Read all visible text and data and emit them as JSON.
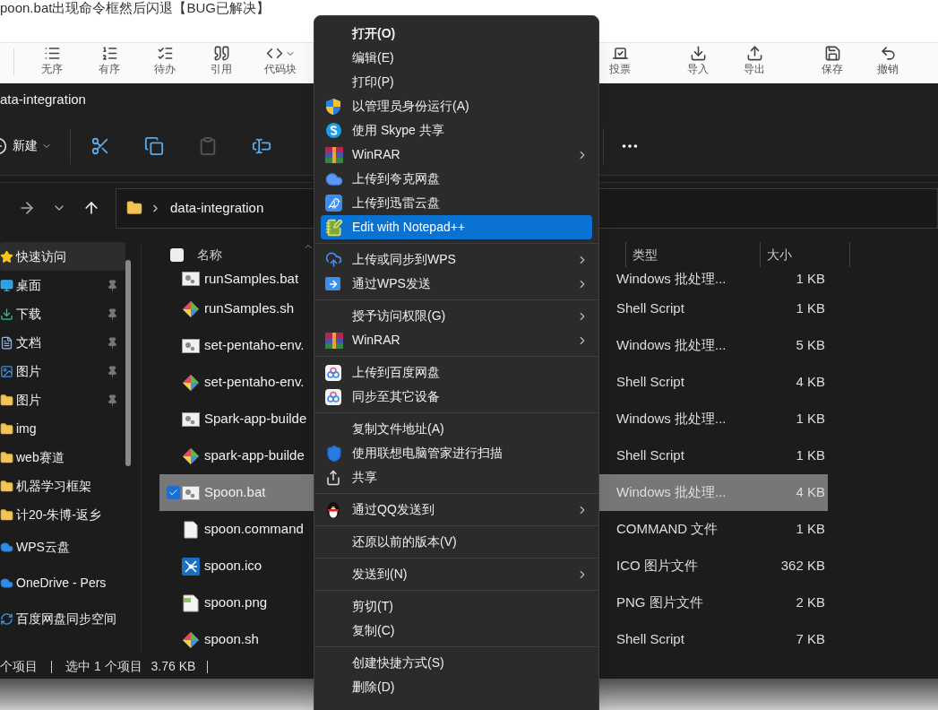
{
  "article": {
    "title": "poon.bat出现命令框然后闪退【BUG已解决】",
    "toolbar": [
      {
        "label": "无序"
      },
      {
        "label": "有序"
      },
      {
        "label": "待办"
      },
      {
        "label": "引用"
      },
      {
        "label": "代码块"
      },
      {
        "label": "投票"
      },
      {
        "label": "导入"
      },
      {
        "label": "导出"
      },
      {
        "label": "保存"
      },
      {
        "label": "撤销"
      }
    ]
  },
  "explorer": {
    "title": "ata-integration",
    "command_bar": {
      "new_label": "新建"
    },
    "address": {
      "path": "data-integration"
    },
    "sidebar": [
      {
        "label": "快速访问",
        "kind": "star",
        "pinned": false,
        "selected": true
      },
      {
        "label": "桌面",
        "kind": "desktop",
        "pinned": true,
        "selected": false
      },
      {
        "label": "下载",
        "kind": "download",
        "pinned": true,
        "selected": false
      },
      {
        "label": "文档",
        "kind": "document",
        "pinned": true,
        "selected": false
      },
      {
        "label": "图片",
        "kind": "picture",
        "pinned": true,
        "selected": false
      },
      {
        "label": "图片",
        "kind": "folder",
        "pinned": true,
        "selected": false
      },
      {
        "label": "img",
        "kind": "folder",
        "pinned": false,
        "selected": false
      },
      {
        "label": "web赛道",
        "kind": "folder",
        "pinned": false,
        "selected": false
      },
      {
        "label": "机器学习框架",
        "kind": "folder",
        "pinned": false,
        "selected": false
      },
      {
        "label": "计20-朱博-返乡",
        "kind": "folder",
        "pinned": false,
        "selected": false
      },
      {
        "label": "WPS云盘",
        "kind": "cloud",
        "pinned": false,
        "selected": false
      },
      {
        "label": "OneDrive - Pers",
        "kind": "cloud",
        "pinned": false,
        "selected": false
      },
      {
        "label": "百度网盘同步空间",
        "kind": "sync",
        "pinned": false,
        "selected": false
      }
    ],
    "columns": [
      "名称",
      "类型",
      "大小"
    ],
    "select_all": {
      "checked": false
    },
    "files": [
      {
        "name": "runSamples.bat",
        "type": "Windows 批处理...",
        "size": "1 KB",
        "kind": "bat",
        "selected": false
      },
      {
        "name": "runSamples.sh",
        "type": "Shell Script",
        "size": "1 KB",
        "kind": "sh",
        "selected": false
      },
      {
        "name": "set-pentaho-env.",
        "type": "Windows 批处理...",
        "size": "5 KB",
        "kind": "bat",
        "selected": false
      },
      {
        "name": "set-pentaho-env.",
        "type": "Shell Script",
        "size": "4 KB",
        "kind": "sh",
        "selected": false
      },
      {
        "name": "Spark-app-builde",
        "type": "Windows 批处理...",
        "size": "1 KB",
        "kind": "bat",
        "selected": false
      },
      {
        "name": "spark-app-builde",
        "type": "Shell Script",
        "size": "1 KB",
        "kind": "sh",
        "selected": false
      },
      {
        "name": "Spoon.bat",
        "type": "Windows 批处理...",
        "size": "4 KB",
        "kind": "bat",
        "selected": true
      },
      {
        "name": "spoon.command",
        "type": "COMMAND 文件",
        "size": "1 KB",
        "kind": "blank",
        "selected": false
      },
      {
        "name": "spoon.ico",
        "type": "ICO 图片文件",
        "size": "362 KB",
        "kind": "ico",
        "selected": false
      },
      {
        "name": "spoon.png",
        "type": "PNG 图片文件",
        "size": "2 KB",
        "kind": "png",
        "selected": false
      },
      {
        "name": "spoon.sh",
        "type": "Shell Script",
        "size": "7 KB",
        "kind": "sh",
        "selected": false
      }
    ],
    "status": [
      "个项目",
      "选中 1 个项目",
      "3.76 KB"
    ]
  },
  "context_menu": [
    [
      {
        "label": "打开(O)",
        "kind": "none",
        "default": true,
        "selected": false,
        "submenu": false
      },
      {
        "label": "编辑(E)",
        "kind": "none",
        "default": false,
        "selected": false,
        "submenu": false
      },
      {
        "label": "打印(P)",
        "kind": "none",
        "default": false,
        "selected": false,
        "submenu": false
      },
      {
        "label": "以管理员身份运行(A)",
        "kind": "shield",
        "default": false,
        "selected": false,
        "submenu": false
      },
      {
        "label": "使用 Skype 共享",
        "kind": "skype",
        "default": false,
        "selected": false,
        "submenu": false
      },
      {
        "label": "WinRAR",
        "kind": "archive",
        "default": false,
        "selected": false,
        "submenu": true
      },
      {
        "label": "上传到夸克网盘",
        "kind": "cloud",
        "default": false,
        "selected": false,
        "submenu": false
      },
      {
        "label": "上传到迅雷云盘",
        "kind": "bird",
        "default": false,
        "selected": false,
        "submenu": false
      },
      {
        "label": "Edit with Notepad++",
        "kind": "notepad",
        "default": false,
        "selected": true,
        "submenu": false
      }
    ],
    [
      {
        "label": "上传或同步到WPS",
        "kind": "cloud-upload",
        "default": false,
        "selected": false,
        "submenu": true
      },
      {
        "label": "通过WPS发送",
        "kind": "send",
        "default": false,
        "selected": false,
        "submenu": true
      }
    ],
    [
      {
        "label": "授予访问权限(G)",
        "kind": "none",
        "default": false,
        "selected": false,
        "submenu": true
      },
      {
        "label": "WinRAR",
        "kind": "archive",
        "default": false,
        "selected": false,
        "submenu": true
      }
    ],
    [
      {
        "label": "上传到百度网盘",
        "kind": "rings",
        "default": false,
        "selected": false,
        "submenu": false
      },
      {
        "label": "同步至其它设备",
        "kind": "rings",
        "default": false,
        "selected": false,
        "submenu": false
      }
    ],
    [
      {
        "label": "复制文件地址(A)",
        "kind": "none",
        "default": false,
        "selected": false,
        "submenu": false
      },
      {
        "label": "使用联想电脑管家进行扫描",
        "kind": "guard",
        "default": false,
        "selected": false,
        "submenu": false
      },
      {
        "label": "共享",
        "kind": "share",
        "default": false,
        "selected": false,
        "submenu": false
      }
    ],
    [
      {
        "label": "通过QQ发送到",
        "kind": "penguin",
        "default": false,
        "selected": false,
        "submenu": true
      }
    ],
    [
      {
        "label": "还原以前的版本(V)",
        "kind": "none",
        "default": false,
        "selected": false,
        "submenu": false
      }
    ],
    [
      {
        "label": "发送到(N)",
        "kind": "none",
        "default": false,
        "selected": false,
        "submenu": true
      }
    ],
    [
      {
        "label": "剪切(T)",
        "kind": "none",
        "default": false,
        "selected": false,
        "submenu": false
      },
      {
        "label": "复制(C)",
        "kind": "none",
        "default": false,
        "selected": false,
        "submenu": false
      }
    ],
    [
      {
        "label": "创建快捷方式(S)",
        "kind": "none",
        "default": false,
        "selected": false,
        "submenu": false
      },
      {
        "label": "删除(D)",
        "kind": "none",
        "default": false,
        "selected": false,
        "submenu": false
      }
    ]
  ]
}
